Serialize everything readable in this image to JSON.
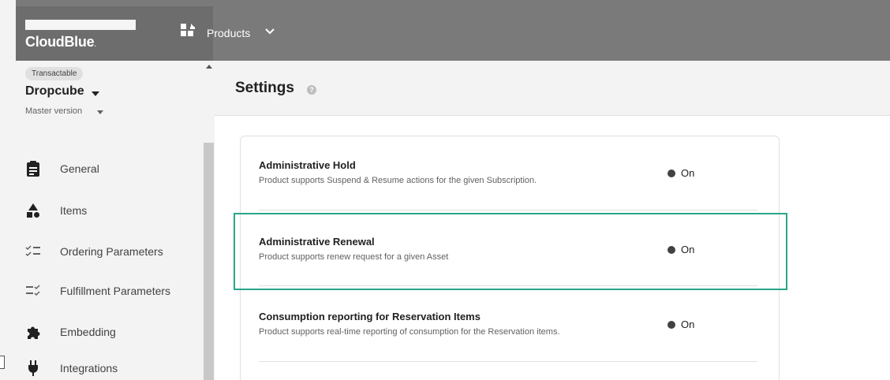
{
  "header": {
    "logo_text": "CloudBlue",
    "menu_label": "Products"
  },
  "product": {
    "badge": "Transactable",
    "name": "Dropcube",
    "version": "Master version"
  },
  "sidebar": {
    "items": [
      {
        "label": "General",
        "icon": "clipboard-icon"
      },
      {
        "label": "Items",
        "icon": "shapes-icon"
      },
      {
        "label": "Ordering Parameters",
        "icon": "checklist-icon"
      },
      {
        "label": "Fulfillment Parameters",
        "icon": "checklist-alt-icon"
      },
      {
        "label": "Embedding",
        "icon": "puzzle-icon"
      },
      {
        "label": "Integrations",
        "icon": "plug-icon"
      }
    ]
  },
  "page": {
    "title": "Settings"
  },
  "settings": [
    {
      "title": "Administrative Hold",
      "description": "Product supports Suspend & Resume actions for the given Subscription.",
      "status": "On"
    },
    {
      "title": "Administrative Renewal",
      "description": "Product supports renew request for a given Asset",
      "status": "On"
    },
    {
      "title": "Consumption reporting for Reservation Items",
      "description": "Product supports real-time reporting of consumption for the Reservation items.",
      "status": "On"
    }
  ],
  "colors": {
    "header_bg": "#7a7a7a",
    "highlight": "#2aa589",
    "status_dot": "#424242"
  }
}
